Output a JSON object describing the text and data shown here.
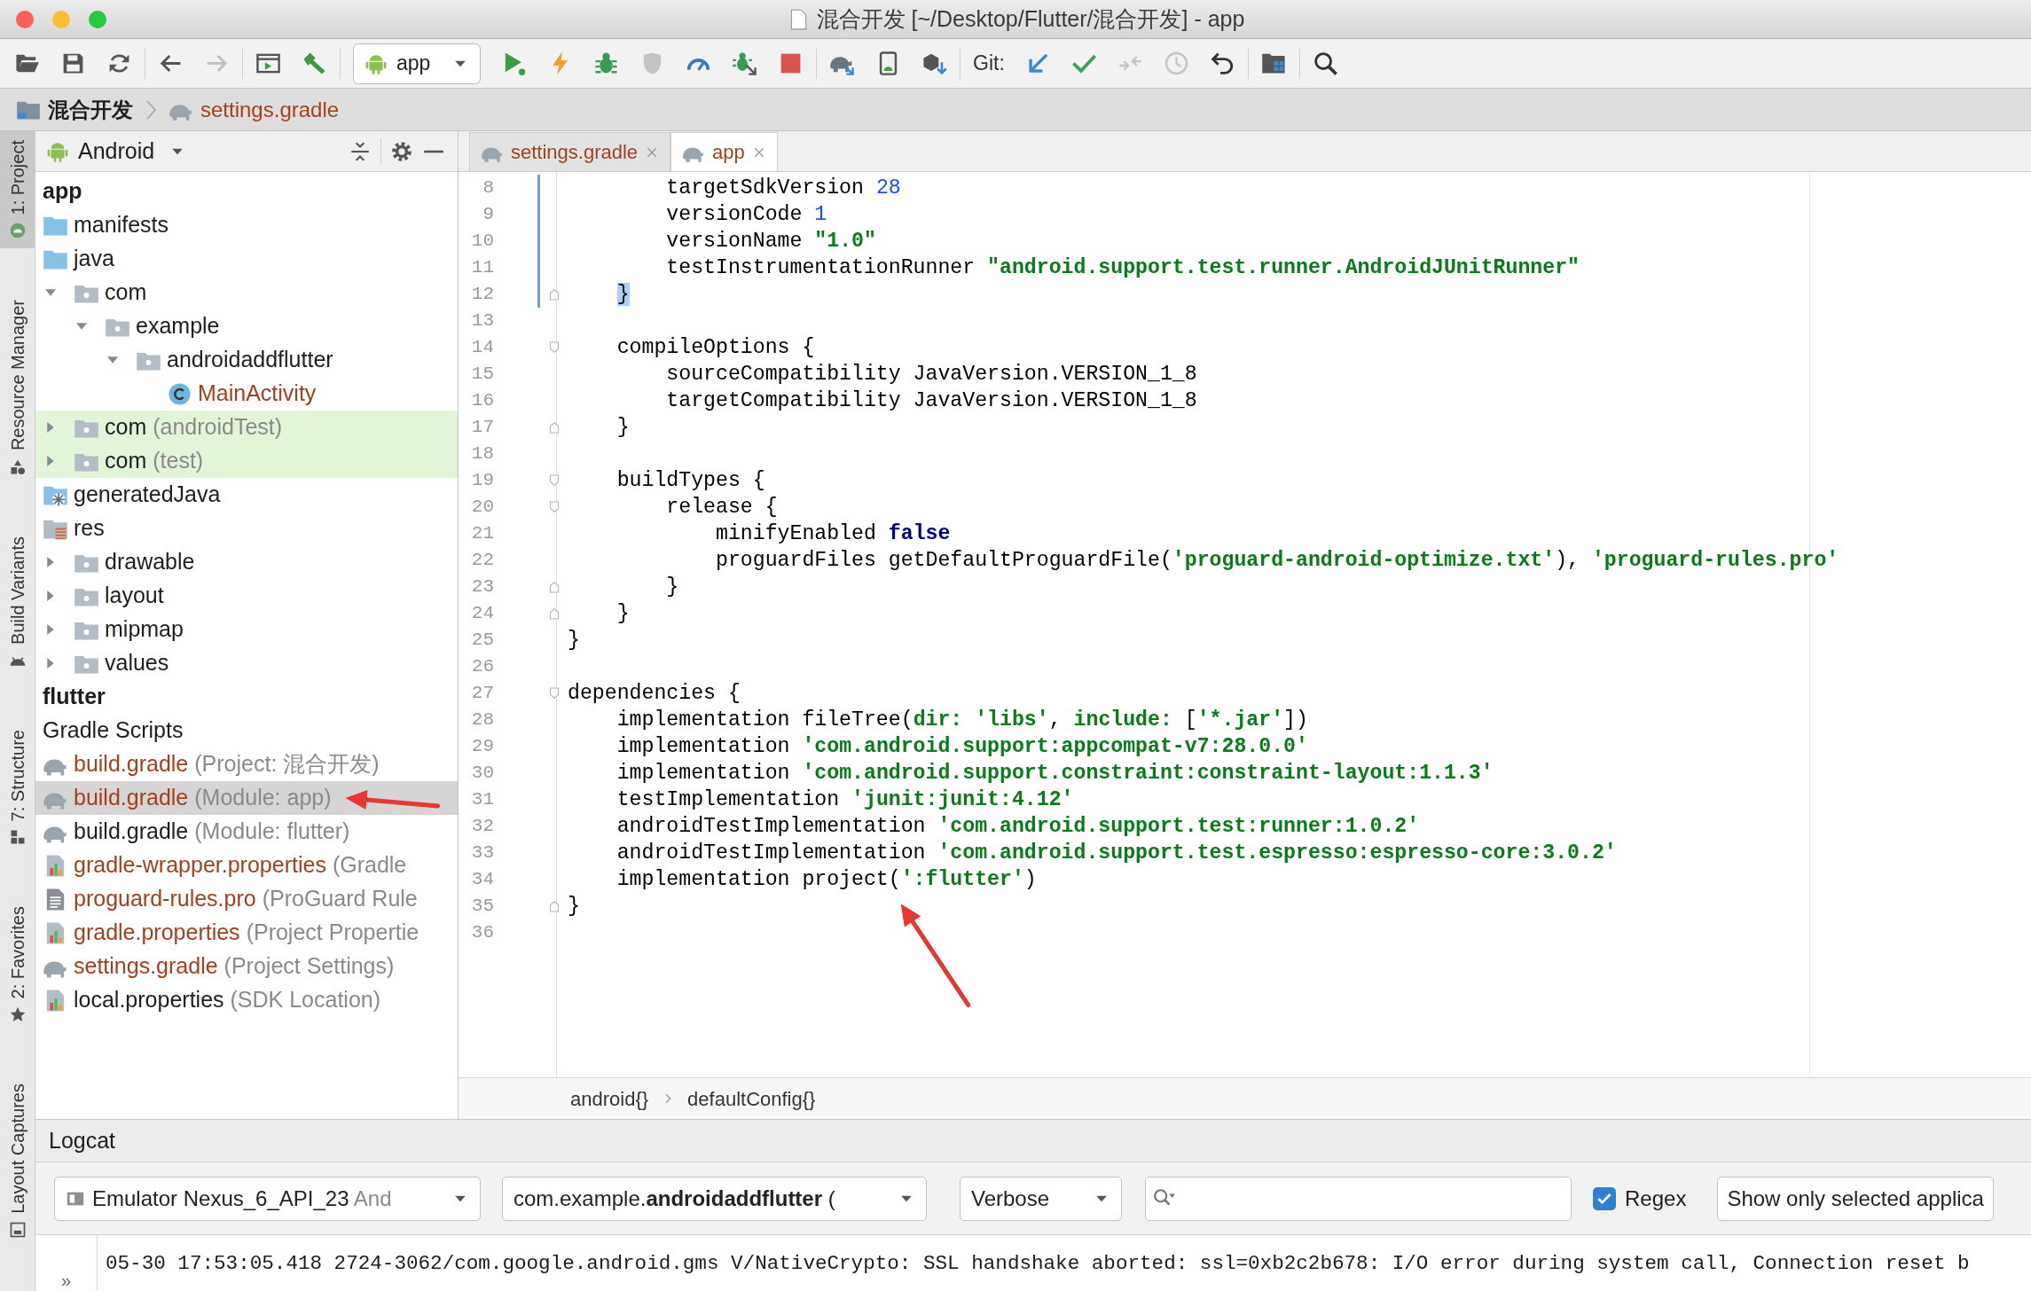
{
  "window": {
    "title": "混合开发 [~/Desktop/Flutter/混合开发] - app"
  },
  "toolbar": {
    "groups": [
      [
        {
          "kind": "open",
          "disabled": false
        },
        {
          "kind": "save",
          "disabled": false
        },
        {
          "kind": "sync",
          "disabled": false
        }
      ],
      [
        {
          "kind": "back",
          "disabled": false
        },
        {
          "kind": "forward",
          "disabled": true
        }
      ],
      [
        {
          "kind": "run-window",
          "disabled": false
        },
        {
          "kind": "build",
          "disabled": false
        }
      ],
      [
        {
          "kind": "dropdown",
          "label": "app"
        },
        {
          "kind": "run",
          "disabled": false
        },
        {
          "kind": "apply",
          "disabled": false
        },
        {
          "kind": "debug",
          "disabled": false
        },
        {
          "kind": "coverage",
          "disabled": true
        },
        {
          "kind": "profile",
          "disabled": false
        },
        {
          "kind": "attach",
          "disabled": false
        },
        {
          "kind": "stop",
          "disabled": false
        }
      ],
      [
        {
          "kind": "gradle-sync",
          "disabled": false
        },
        {
          "kind": "avd",
          "disabled": false
        },
        {
          "kind": "sdk",
          "disabled": false
        }
      ],
      [
        {
          "kind": "label",
          "text": "Git:"
        },
        {
          "kind": "git-update",
          "disabled": false
        },
        {
          "kind": "git-commit",
          "disabled": false
        },
        {
          "kind": "git-compare",
          "disabled": true
        },
        {
          "kind": "history",
          "disabled": true
        },
        {
          "kind": "rollback",
          "disabled": false
        }
      ],
      [
        {
          "kind": "structure",
          "disabled": false
        }
      ],
      [
        {
          "kind": "search",
          "disabled": false
        }
      ]
    ]
  },
  "navigation_bar": [
    {
      "kind": "project",
      "text": "混合开发"
    },
    {
      "kind": "gradle",
      "text": "settings.gradle"
    }
  ],
  "tool_windows": [
    {
      "label": "1: Project",
      "selected": true
    },
    {
      "label": "Resource Manager",
      "selected": false
    },
    {
      "label": "Build Variants",
      "selected": false
    },
    {
      "label": "7: Structure",
      "selected": false
    },
    {
      "label": "2: Favorites",
      "selected": false
    },
    {
      "label": "Layout Captures",
      "selected": false
    }
  ],
  "project_panel": {
    "view": "Android",
    "tree": [
      {
        "kind": "module",
        "text": "app",
        "selected": false
      },
      {
        "kind": "source-folder",
        "text": "manifests",
        "selected": false,
        "unversioned": false
      },
      {
        "kind": "source-folder",
        "text": "java",
        "selected": false,
        "unversioned": false,
        "children": [
          {
            "kind": "package",
            "text": "com",
            "selected": false,
            "unversioned": false,
            "expanded": true,
            "children": [
              {
                "kind": "package",
                "text": "example",
                "selected": false,
                "unversioned": false,
                "expanded": true,
                "children": [
                  {
                    "kind": "package",
                    "text": "androidaddflutter",
                    "selected": false,
                    "unversioned": false,
                    "expanded": true,
                    "children": [
                      {
                        "kind": "class",
                        "text": "MainActivity",
                        "selected": false,
                        "unversioned": true
                      }
                    ]
                  }
                ]
              }
            ]
          },
          {
            "kind": "package",
            "text": "com",
            "note": "(androidTest)",
            "selected": false,
            "unversioned": false,
            "expanded": false,
            "test_source": true
          },
          {
            "kind": "package",
            "text": "com",
            "note": "(test)",
            "selected": false,
            "unversioned": false,
            "expanded": false,
            "test_source": true
          }
        ]
      },
      {
        "kind": "generated-folder",
        "text": "generatedJava",
        "selected": false,
        "unversioned": false
      },
      {
        "kind": "res-folder",
        "text": "res",
        "selected": false,
        "unversioned": false,
        "children": [
          {
            "kind": "package",
            "text": "drawable",
            "selected": false,
            "unversioned": false,
            "expanded": false
          },
          {
            "kind": "package",
            "text": "layout",
            "selected": false,
            "unversioned": false,
            "expanded": false
          },
          {
            "kind": "package",
            "text": "mipmap",
            "selected": false,
            "unversioned": false,
            "expanded": false
          },
          {
            "kind": "package",
            "text": "values",
            "selected": false,
            "unversioned": false,
            "expanded": false
          }
        ]
      },
      {
        "kind": "module",
        "text": "flutter",
        "selected": false
      },
      {
        "kind": "group",
        "text": "Gradle Scripts",
        "selected": false
      },
      {
        "kind": "gradle-script",
        "text": "build.gradle",
        "note": "(Project: 混合开发)",
        "selected": false,
        "unversioned": true
      },
      {
        "kind": "gradle-script",
        "text": "build.gradle",
        "note": "(Module: app)",
        "selected": true,
        "unversioned": true
      },
      {
        "kind": "gradle-script",
        "text": "build.gradle",
        "note": "(Module: flutter)",
        "selected": false,
        "unversioned": false
      },
      {
        "kind": "properties-file",
        "text": "gradle-wrapper.properties",
        "note": "(Gradle",
        "selected": false,
        "unversioned": true
      },
      {
        "kind": "text-file",
        "text": "proguard-rules.pro",
        "note": "(ProGuard Rule",
        "selected": false,
        "unversioned": true
      },
      {
        "kind": "properties-file",
        "text": "gradle.properties",
        "note": "(Project Propertie",
        "selected": false,
        "unversioned": true
      },
      {
        "kind": "gradle-script",
        "text": "settings.gradle",
        "note": "(Project Settings)",
        "selected": false,
        "unversioned": true
      },
      {
        "kind": "properties-file",
        "text": "local.properties",
        "note": "(SDK Location)",
        "selected": false,
        "unversioned": false
      }
    ]
  },
  "editor": {
    "tabs": [
      {
        "label": "settings.gradle",
        "selected": false,
        "unversioned": true
      },
      {
        "label": "app",
        "selected": true,
        "unversioned": true
      }
    ],
    "lines": [
      {
        "number": "8",
        "changed": true,
        "fold": false,
        "tokens": [
          {
            "kind": "plain",
            "text": "        targetSdkVersion "
          },
          {
            "kind": "number",
            "text": "28"
          }
        ]
      },
      {
        "number": "9",
        "changed": true,
        "fold": false,
        "tokens": [
          {
            "kind": "plain",
            "text": "        versionCode "
          },
          {
            "kind": "number",
            "text": "1"
          }
        ]
      },
      {
        "number": "10",
        "changed": true,
        "fold": false,
        "tokens": [
          {
            "kind": "plain",
            "text": "        versionName "
          },
          {
            "kind": "string",
            "text": "\"1.0\""
          }
        ]
      },
      {
        "number": "11",
        "changed": true,
        "fold": false,
        "tokens": [
          {
            "kind": "plain",
            "text": "        testInstrumentationRunner "
          },
          {
            "kind": "string",
            "text": "\"android.support.test.runner.AndroidJUnitRunner\""
          }
        ]
      },
      {
        "number": "12",
        "changed": true,
        "fold": true,
        "bracket_match": true,
        "tokens": [
          {
            "kind": "plain",
            "text": "    }"
          }
        ]
      },
      {
        "number": "13",
        "changed": false,
        "fold": false
      },
      {
        "number": "14",
        "changed": false,
        "fold": true,
        "tokens": [
          {
            "kind": "plain",
            "text": "    compileOptions {"
          }
        ]
      },
      {
        "number": "15",
        "changed": false,
        "fold": false,
        "tokens": [
          {
            "kind": "plain",
            "text": "        sourceCompatibility JavaVersion.VERSION_1_8"
          }
        ]
      },
      {
        "number": "16",
        "changed": false,
        "fold": false,
        "tokens": [
          {
            "kind": "plain",
            "text": "        targetCompatibility JavaVersion.VERSION_1_8"
          }
        ]
      },
      {
        "number": "17",
        "changed": false,
        "fold": true,
        "tokens": [
          {
            "kind": "plain",
            "text": "    }"
          }
        ]
      },
      {
        "number": "18",
        "changed": false,
        "fold": false
      },
      {
        "number": "19",
        "changed": false,
        "fold": true,
        "tokens": [
          {
            "kind": "plain",
            "text": "    buildTypes {"
          }
        ]
      },
      {
        "number": "20",
        "changed": false,
        "fold": true,
        "tokens": [
          {
            "kind": "plain",
            "text": "        release {"
          }
        ]
      },
      {
        "number": "21",
        "changed": false,
        "fold": false,
        "tokens": [
          {
            "kind": "plain",
            "text": "            minifyEnabled "
          },
          {
            "kind": "keyword",
            "text": "false"
          }
        ]
      },
      {
        "number": "22",
        "changed": false,
        "fold": false,
        "tokens": [
          {
            "kind": "plain",
            "text": "            proguardFiles getDefaultProguardFile("
          },
          {
            "kind": "string",
            "text": "'proguard-android-optimize.txt'"
          },
          {
            "kind": "plain",
            "text": "), "
          },
          {
            "kind": "string",
            "text": "'proguard-rules.pro'"
          }
        ]
      },
      {
        "number": "23",
        "changed": false,
        "fold": true,
        "tokens": [
          {
            "kind": "plain",
            "text": "        }"
          }
        ]
      },
      {
        "number": "24",
        "changed": false,
        "fold": true,
        "tokens": [
          {
            "kind": "plain",
            "text": "    }"
          }
        ]
      },
      {
        "number": "25",
        "changed": false,
        "fold": false,
        "tokens": [
          {
            "kind": "plain",
            "text": "}"
          }
        ]
      },
      {
        "number": "26",
        "changed": false,
        "fold": false
      },
      {
        "number": "27",
        "changed": false,
        "fold": true,
        "tokens": [
          {
            "kind": "plain",
            "text": "dependencies {"
          }
        ]
      },
      {
        "number": "28",
        "changed": false,
        "fold": false,
        "tokens": [
          {
            "kind": "plain",
            "text": "    implementation fileTree("
          },
          {
            "kind": "named",
            "text": "dir: "
          },
          {
            "kind": "string",
            "text": "'libs'"
          },
          {
            "kind": "plain",
            "text": ", "
          },
          {
            "kind": "named",
            "text": "include: "
          },
          {
            "kind": "plain",
            "text": "["
          },
          {
            "kind": "string",
            "text": "'*.jar'"
          },
          {
            "kind": "plain",
            "text": "])"
          }
        ]
      },
      {
        "number": "29",
        "changed": false,
        "fold": false,
        "tokens": [
          {
            "kind": "plain",
            "text": "    implementation "
          },
          {
            "kind": "string",
            "text": "'com.android.support:appcompat-v7:28.0.0'"
          }
        ]
      },
      {
        "number": "30",
        "changed": false,
        "fold": false,
        "tokens": [
          {
            "kind": "plain",
            "text": "    implementation "
          },
          {
            "kind": "string",
            "text": "'com.android.support.constraint:constraint-layout:1.1.3'"
          }
        ]
      },
      {
        "number": "31",
        "changed": false,
        "fold": false,
        "tokens": [
          {
            "kind": "plain",
            "text": "    testImplementation "
          },
          {
            "kind": "string",
            "text": "'junit:junit:4.12'"
          }
        ]
      },
      {
        "number": "32",
        "changed": false,
        "fold": false,
        "tokens": [
          {
            "kind": "plain",
            "text": "    androidTestImplementation "
          },
          {
            "kind": "string",
            "text": "'com.android.support.test:runner:1.0.2'"
          }
        ]
      },
      {
        "number": "33",
        "changed": false,
        "fold": false,
        "tokens": [
          {
            "kind": "plain",
            "text": "    androidTestImplementation "
          },
          {
            "kind": "string",
            "text": "'com.android.support.test.espresso:espresso-core:3.0.2'"
          }
        ]
      },
      {
        "number": "34",
        "changed": false,
        "fold": false,
        "tokens": [
          {
            "kind": "plain",
            "text": "    implementation project("
          },
          {
            "kind": "string",
            "text": "':flutter'"
          },
          {
            "kind": "plain",
            "text": ")"
          }
        ]
      },
      {
        "number": "35",
        "changed": false,
        "fold": true,
        "tokens": [
          {
            "kind": "plain",
            "text": "}"
          }
        ]
      },
      {
        "number": "36",
        "changed": false,
        "fold": false
      }
    ],
    "breadcrumbs": [
      "android{}",
      "defaultConfig{}"
    ]
  },
  "logcat": {
    "title": "Logcat",
    "device": {
      "name": "Emulator Nexus_6_API_23",
      "detail": "And"
    },
    "process": "com.example.**androidaddflutter** (",
    "level": "Verbose",
    "regex": {
      "label": "Regex",
      "checked": true
    },
    "filter": "Show only selected applica",
    "gutter_mark": "»",
    "lines": [
      "05-30 17:53:05.418 2724-3062/com.google.android.gms V/NativeCrypto: SSL handshake aborted: ssl=0xb2c2b678: I/O error during system call, Connection reset b"
    ]
  },
  "annotations": [
    {
      "kind": "arrow"
    },
    {
      "kind": "arrow"
    }
  ]
}
